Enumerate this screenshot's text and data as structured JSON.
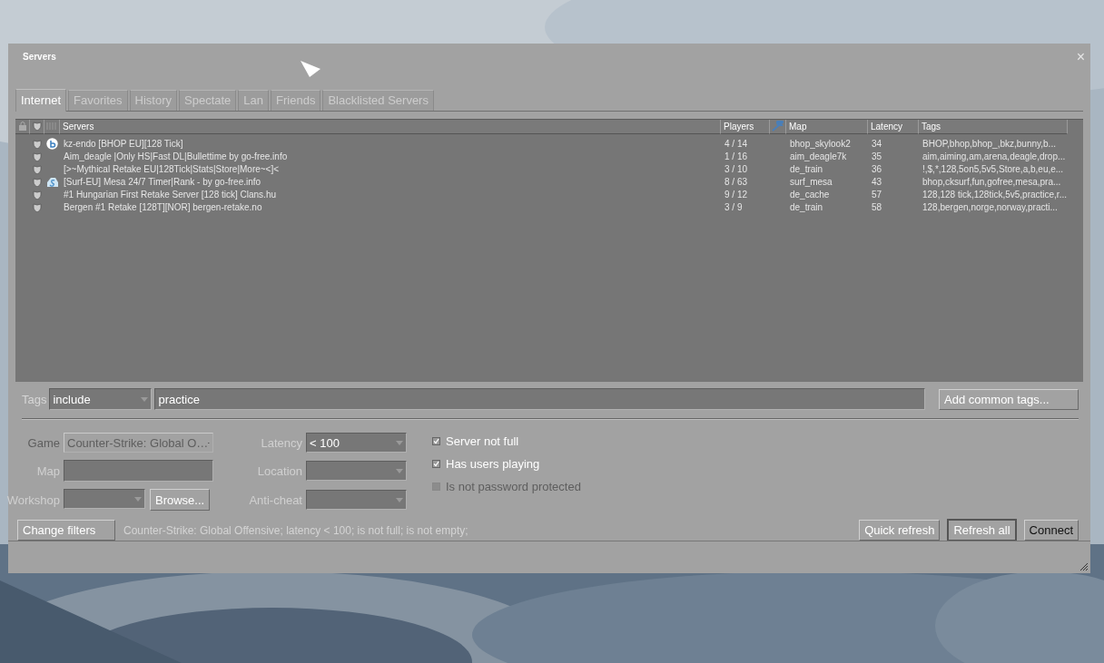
{
  "window": {
    "title": "Servers",
    "close": "×"
  },
  "tabs": [
    {
      "label": "Internet",
      "selected": true
    },
    {
      "label": "Favorites",
      "selected": false
    },
    {
      "label": "History",
      "selected": false
    },
    {
      "label": "Spectate",
      "selected": false
    },
    {
      "label": "Lan",
      "selected": false
    },
    {
      "label": "Friends",
      "selected": false
    },
    {
      "label": "Blacklisted Servers",
      "selected": false
    }
  ],
  "table": {
    "columns": [
      "Servers",
      "Players",
      "Map",
      "Latency",
      "Tags"
    ],
    "rows": [
      {
        "kind": "circle",
        "name": "kz-endo [BHOP EU][128 Tick]",
        "players": "4 / 14",
        "map": "bhop_skylook2",
        "latency": "34",
        "tags": "BHOP,bhop,bhop_,bkz,bunny,b..."
      },
      {
        "kind": "plain",
        "name": "Aim_deagle |Only HS|Fast DL|Bullettime by go-free.info",
        "players": "1 / 16",
        "map": "aim_deagle7k",
        "latency": "35",
        "tags": "aim,aiming,am,arena,deagle,drop..."
      },
      {
        "kind": "plain",
        "name": " [>~Mythical Retake EU|128Tick|Stats|Store|More~<]<",
        "players": "3 / 10",
        "map": "de_train",
        "latency": "36",
        "tags": "!,$,*,128,5on5,5v5,Store,a,b,eu,e..."
      },
      {
        "kind": "cloud",
        "name": "[Surf-EU] Mesa 24/7 Timer|Rank - by go-free.info",
        "players": "8 / 63",
        "map": "surf_mesa",
        "latency": "43",
        "tags": "bhop,cksurf,fun,gofree,mesa,pra..."
      },
      {
        "kind": "plain",
        "name": "#1 Hungarian First Retake Server [128 tick] Clans.hu",
        "players": "9 / 12",
        "map": "de_cache",
        "latency": "57",
        "tags": "128,128 tick,128tick,5v5,practice,r..."
      },
      {
        "kind": "plain",
        "name": "Bergen #1 Retake [128T][NOR] bergen-retake.no",
        "players": "3 / 9",
        "map": "de_train",
        "latency": "58",
        "tags": "128,bergen,norge,norway,practi..."
      }
    ]
  },
  "tags_filter": {
    "label": "Tags",
    "mode": "include",
    "value": "practice",
    "button": "Add common tags..."
  },
  "filters": {
    "game": {
      "label": "Game",
      "value": "Counter-Strike: Global O…",
      "disabled": true
    },
    "map": {
      "label": "Map"
    },
    "workshop": {
      "label": "Workshop",
      "button": "Browse..."
    },
    "latency": {
      "label": "Latency",
      "value": "< 100"
    },
    "location": {
      "label": "Location"
    },
    "anticheat": {
      "label": "Anti-cheat"
    },
    "checks": [
      {
        "label": "Server not full",
        "checked": true,
        "disabled": false
      },
      {
        "label": "Has users playing",
        "checked": true,
        "disabled": false
      },
      {
        "label": "Is not password protected",
        "checked": false,
        "disabled": true
      }
    ]
  },
  "footer": {
    "change_button": "Change filters",
    "summary": "Counter-Strike: Global Offensive; latency < 100; is not full; is not empty;",
    "buttons": [
      "Quick refresh",
      "Refresh all",
      "Connect"
    ]
  }
}
